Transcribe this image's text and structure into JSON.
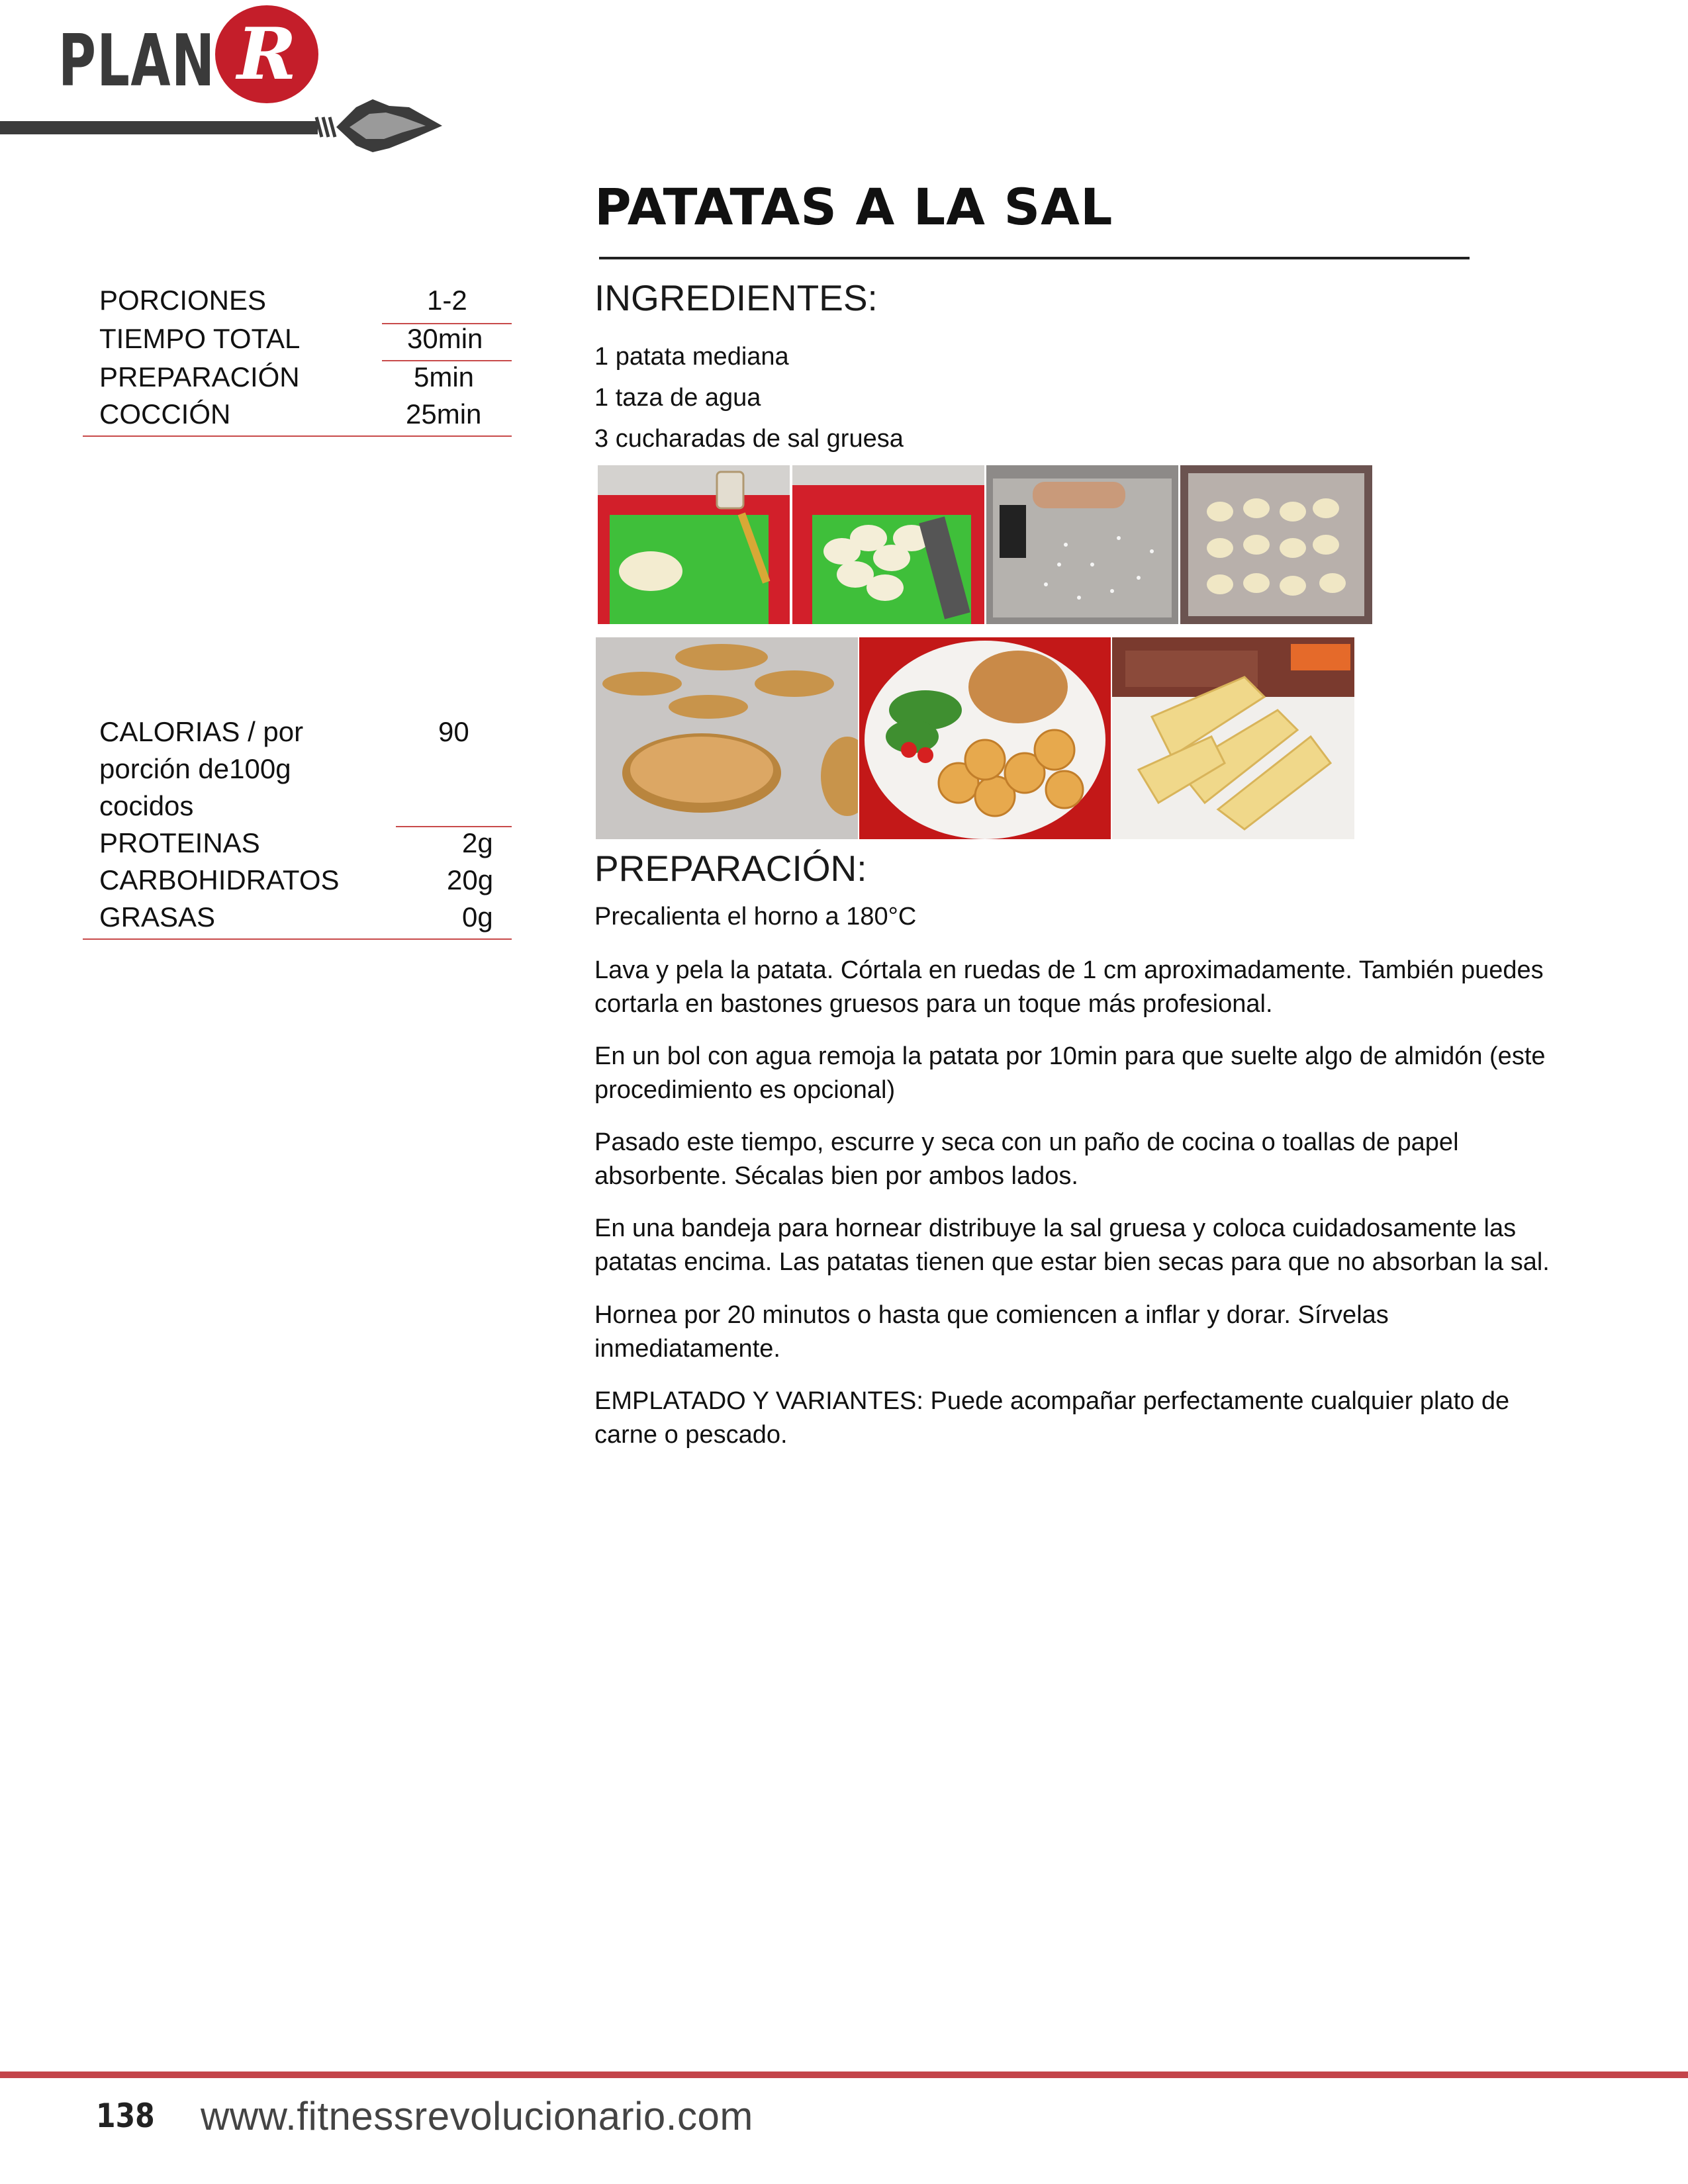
{
  "brand": {
    "logo_text": "PLAN",
    "logo_letter": "R"
  },
  "recipe": {
    "title": "PATATAS A LA SAL"
  },
  "summary": [
    {
      "label": "PORCIONES",
      "value": "1-2"
    },
    {
      "label": "TIEMPO TOTAL",
      "value": "30min"
    },
    {
      "label": "PREPARACIÓN",
      "value": "5min"
    },
    {
      "label": "COCCIÓN",
      "value": "25min"
    }
  ],
  "nutrition": {
    "calories_label_lines": [
      "CALORIAS / por",
      "porción de100g",
      "cocidos"
    ],
    "calories_value": "90",
    "rows": [
      {
        "label": "PROTEINAS",
        "value": "2g"
      },
      {
        "label": "CARBOHIDRATOS",
        "value": "20g"
      },
      {
        "label": "GRASAS",
        "value": "0g"
      }
    ]
  },
  "ingredients": {
    "heading": "INGREDIENTES:",
    "items": [
      "1 patata mediana",
      "1 taza de agua",
      "3 cucharadas de sal gruesa"
    ]
  },
  "preparation": {
    "heading": "PREPARACIÓN:",
    "steps": [
      "Precalienta el horno a 180°C",
      "Lava y pela la patata. Córtala en ruedas de 1 cm  aproximadamente. También puedes cortarla en bastones gruesos para un toque más profesional.",
      "En un bol con agua remoja la patata por 10min para que suelte algo de almidón (este procedimiento es opcional)",
      "Pasado este tiempo, escurre y seca con un paño de cocina o toallas de papel absorbente. Sécalas bien por ambos lados.",
      "En una bandeja para hornear distribuye la sal gruesa y coloca cuidadosamente las patatas encima. Las patatas tienen que estar bien secas para que no absorban la sal.",
      "Hornea por 20 minutos o hasta que comiencen a inflar y dorar. Sírvelas inmediatamente.",
      "EMPLATADO Y VARIANTES: Puede acompañar perfectamente cualquier plato de carne o pescado."
    ]
  },
  "footer": {
    "page_number": "138",
    "url": "www.fitnessrevolucionario.com"
  },
  "colors": {
    "brand_red": "#c41e2a",
    "rule_red": "#c84b4b",
    "dark_gray": "#3b3b3b"
  }
}
